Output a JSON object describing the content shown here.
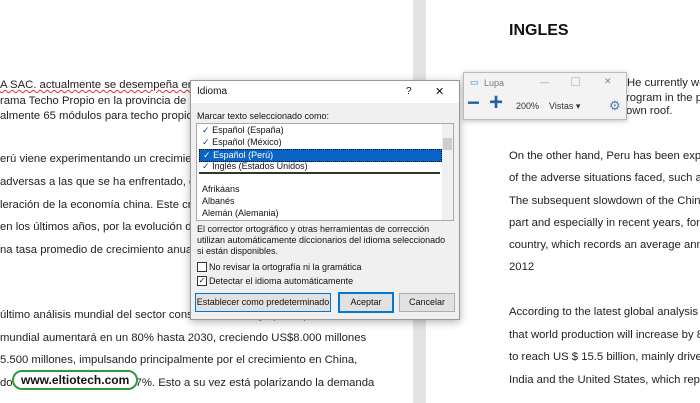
{
  "left_doc": {
    "lines": [
      "A SAC.  actualmente se desempeña en el Sec",
      "rama Techo Propio en la provincia de la ciud",
      "almente 65 módulos para techo propio.",
      "erú viene experimentando un crecimiento e",
      "adversas a las que se ha enfrentado, como la",
      "leración de la economía china. Este crecimie",
      " en los últimos años, por la evolución del sec",
      "na tasa promedio de crecimiento anual del",
      "último análisis mundial del sector construcción a largo plazo pronostica",
      "mundial aumentará en un 80% hasta 2030, creciendo US$8.000 millones",
      "5.500 millones, impulsando principalmente por el crecimiento en China,",
      "dos, el cual representa el 57%. Esto a su vez está polarizando la demanda"
    ]
  },
  "watermark": "www.eltiotech.com",
  "right_doc": {
    "title": "INGLES",
    "lines": [
      "He currently wor",
      "rogram in the pro",
      "own roof.",
      "On the other hand, Peru has been experienc",
      "of the adverse situations faced, such as the f",
      "The subsequent slowdown of the Chinese ec",
      "part and especially in recent years, for the e",
      "country, which records an average annual gr",
      "2012",
      "According to the latest global analysis of the",
      "that world production will increase by 80% u",
      "to reach US $ 15.5 billion, mainly driven by g",
      "India and the United States, which represen"
    ]
  },
  "dialog": {
    "title": "Idioma",
    "help": "?",
    "close": "✕",
    "list_label": "Marcar texto seleccionado como:",
    "languages": [
      "Español (España)",
      "Español (México)",
      "Español (Perú)",
      "Inglés (Estados Unidos)",
      "Afrikáans",
      "Albanés",
      "Alemán (Alemania)"
    ],
    "selected": "Español (Perú)",
    "description": "El corrector ortográfico y otras herramientas de corrección utilizan automáticamente diccionarios del idioma seleccionado si están disponibles.",
    "no_check_label": "No revisar la ortografía ni la gramática",
    "no_check": false,
    "detect_label": "Detectar el idioma automáticamente",
    "detect": true,
    "check_mark": "✓",
    "default_btn": "Establecer como predeterminado",
    "ok_btn": "Aceptar",
    "cancel_btn": "Cancelar"
  },
  "magnifier": {
    "title": "Lupa",
    "zoom": "200%",
    "views": "Vistas ▾",
    "minus": "−",
    "plus": "+",
    "minimize": "—",
    "close": "✕",
    "accent": "#1f5fb0"
  }
}
